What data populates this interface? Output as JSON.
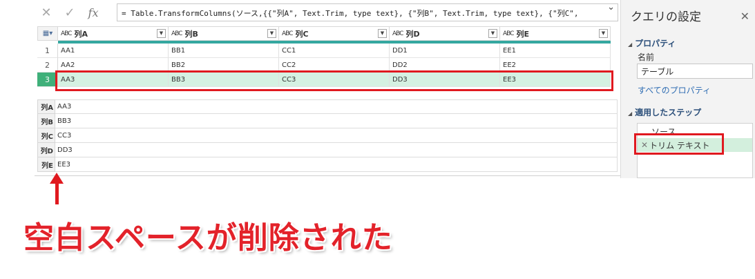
{
  "formula_bar": {
    "cancel_icon": "close-icon",
    "commit_icon": "check-icon",
    "fx_label": "fx",
    "formula": "= Table.TransformColumns(ソース,{{\"列A\", Text.Trim, type text}, {\"列B\", Text.Trim, type text}, {\"列C\","
  },
  "grid": {
    "columns": [
      {
        "type_label": "ABC",
        "name": "列A"
      },
      {
        "type_label": "ABC",
        "name": "列B"
      },
      {
        "type_label": "ABC",
        "name": "列C"
      },
      {
        "type_label": "ABC",
        "name": "列D"
      },
      {
        "type_label": "ABC",
        "name": "列E"
      }
    ],
    "rows": [
      {
        "num": "1",
        "cells": [
          "AA1",
          "BB1",
          "CC1",
          "DD1",
          "EE1"
        ]
      },
      {
        "num": "2",
        "cells": [
          "AA2",
          "BB2",
          "CC2",
          "DD2",
          "EE2"
        ]
      },
      {
        "num": "3",
        "cells": [
          "AA3",
          "BB3",
          "CC3",
          "DD3",
          "EE3"
        ]
      }
    ],
    "selected_row": 3
  },
  "detail": [
    {
      "label": "列A",
      "value": "AA3"
    },
    {
      "label": "列B",
      "value": "BB3"
    },
    {
      "label": "列C",
      "value": "CC3"
    },
    {
      "label": "列D",
      "value": "DD3"
    },
    {
      "label": "列E",
      "value": "EE3"
    }
  ],
  "query_settings": {
    "title": "クエリの設定",
    "properties_header": "プロパティ",
    "name_label": "名前",
    "name_value": "テーブル",
    "all_properties_link": "すべてのプロパティ",
    "applied_steps_header": "適用したステップ",
    "steps": [
      {
        "label": "ソース",
        "active": false
      },
      {
        "label": "トリム テキスト",
        "active": true
      }
    ]
  },
  "annotation": {
    "text": "空白スペースが削除された",
    "color": "#e3222a"
  },
  "colors": {
    "accent_teal": "#34a7a0",
    "selected_row": "#d5f1e2",
    "highlight_red": "#e0191f"
  }
}
